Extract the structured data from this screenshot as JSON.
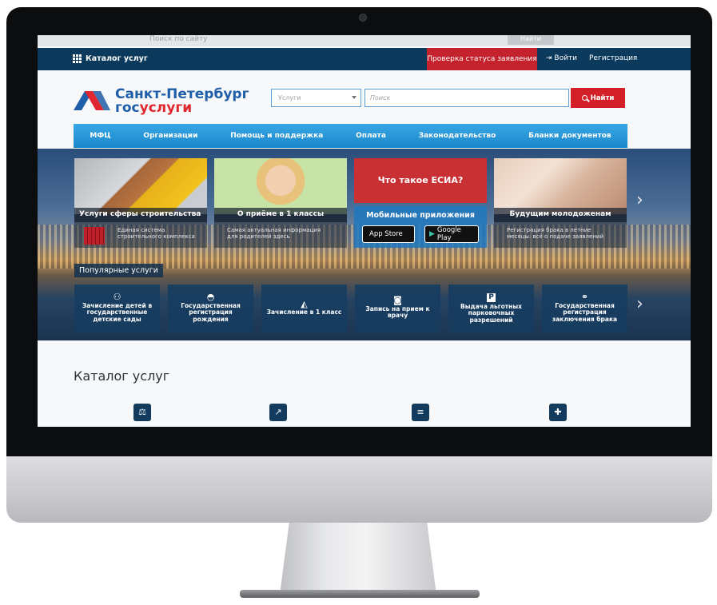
{
  "topbar": {
    "catalog_label": "Каталог услуг",
    "status_label": "Проверка статуса заявления",
    "login_label": "Войти",
    "register_label": "Регистрация"
  },
  "ghost": {
    "search_placeholder": "Поиск по сайту",
    "button_label": "Найти"
  },
  "logo": {
    "city": "Санкт-Петербург",
    "gos_prefix": "гос",
    "gos_suffix": "услуги"
  },
  "search": {
    "select_value": "Услуги",
    "placeholder": "Поиск",
    "button_label": "Найти"
  },
  "menu": [
    "МФЦ",
    "Организации",
    "Помощь и поддержка",
    "Оплата",
    "Законодательство",
    "Бланки документов"
  ],
  "cards": {
    "construction": {
      "title": "Услуги сферы строительства",
      "text": "Единая система\nстроительного комплекса"
    },
    "school": {
      "title": "О приёме в 1 классы",
      "text": "Самая актуальная информация\nдля родителей здесь"
    },
    "esia": {
      "title": "Что такое ЕСИА?"
    },
    "mobile": {
      "title": "Мобильные приложения",
      "apple": "App Store",
      "google": "Google Play"
    },
    "wedding": {
      "title": "Будущим молодоженам",
      "text": "Регистрация брака в летние\nмесяцы: всё о подаче заявлений"
    }
  },
  "popular": {
    "label": "Популярные услуги",
    "tiles": [
      {
        "label": "Зачисление детей в государственные детские сады",
        "icon": "children-icon"
      },
      {
        "label": "Государственная регистрация рождения",
        "icon": "stroller-icon"
      },
      {
        "label": "Зачисление в 1 класс",
        "icon": "bell-icon"
      },
      {
        "label": "Запись на прием к врачу",
        "icon": "medical-icon"
      },
      {
        "label": "Выдача льготных парковочных разрешений",
        "icon": "parking-icon"
      },
      {
        "label": "Государственная регистрация заключения брака",
        "icon": "rings-icon"
      }
    ]
  },
  "catalog": {
    "title": "Каталог услуг"
  },
  "colors": {
    "navbar": "#0b3a5c",
    "status": "#c4222c",
    "menu": "#1b87cc",
    "search_button": "#d32028",
    "brand_blue": "#1f5ea8",
    "brand_red": "#e0262f"
  }
}
